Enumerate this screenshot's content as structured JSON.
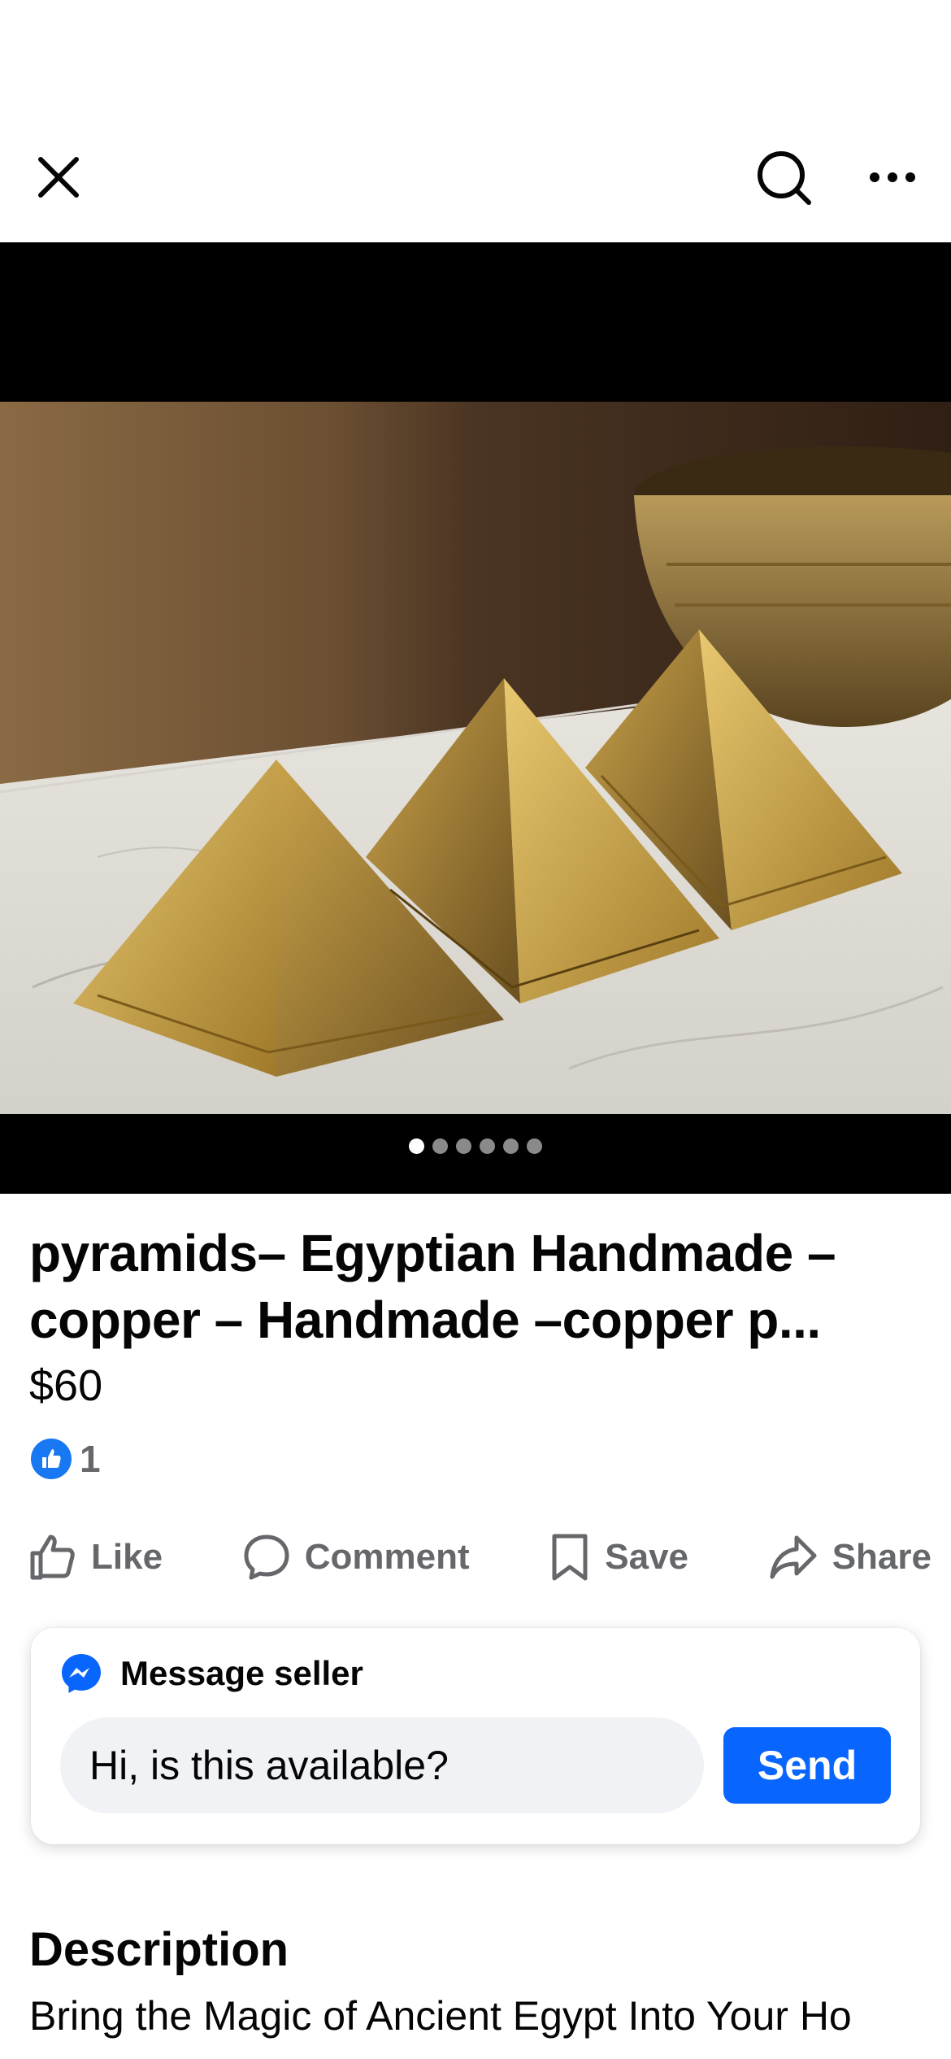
{
  "header": {
    "close_icon": "close-icon",
    "search_icon": "search-icon",
    "more_icon": "more-options-icon"
  },
  "media": {
    "photo_description_icon": "product-photo",
    "total_images": 6,
    "active_index": 0
  },
  "listing": {
    "title": "pyramids– Egyptian Handmade –copper – Handmade –copper p...",
    "price": "$60"
  },
  "reactions": {
    "icon": "like-reaction-icon",
    "count": "1"
  },
  "actions": [
    {
      "label": "Like",
      "icon": "thumbs-up-icon"
    },
    {
      "label": "Comment",
      "icon": "comment-icon"
    },
    {
      "label": "Save",
      "icon": "bookmark-icon"
    },
    {
      "label": "Share",
      "icon": "share-icon"
    }
  ],
  "message_seller": {
    "title": "Message seller",
    "icon": "messenger-icon",
    "input_value": "Hi, is this available?",
    "send_label": "Send"
  },
  "description": {
    "heading": "Description",
    "text": "Bring the Magic of Ancient Egypt Into Your Ho"
  },
  "colors": {
    "accent": "#0866ff",
    "reaction_blue": "#1877f2",
    "muted_text": "#65676b",
    "input_bg": "#f0f2f5"
  }
}
